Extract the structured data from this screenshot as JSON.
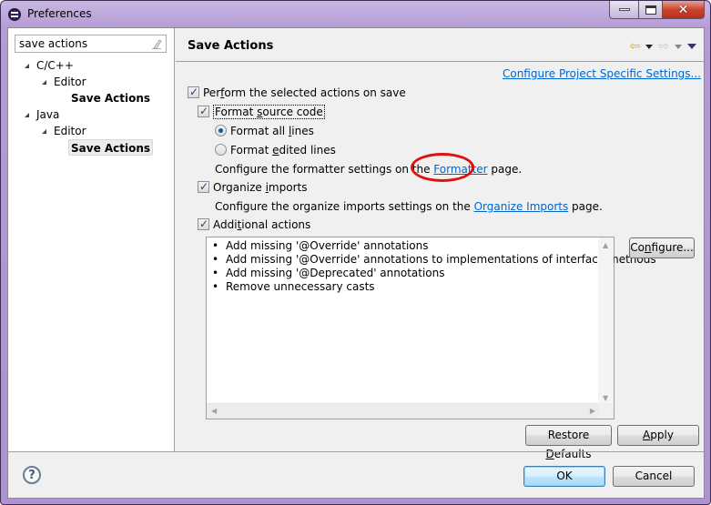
{
  "window": {
    "title": "Preferences",
    "controls": {
      "minimize": "minimize",
      "maximize": "maximize",
      "close": "close"
    }
  },
  "sidebar": {
    "filter": {
      "value": "save actions",
      "placeholder": ""
    },
    "tree": [
      {
        "label": "C/C++",
        "level": 0,
        "expanded": true
      },
      {
        "label": "Editor",
        "level": 1,
        "expanded": true
      },
      {
        "label": "Save Actions",
        "level": 2,
        "bold": true,
        "selected": false
      },
      {
        "label": "Java",
        "level": 0,
        "expanded": true
      },
      {
        "label": "Editor",
        "level": 1,
        "expanded": true
      },
      {
        "label": "Save Actions",
        "level": 2,
        "bold": true,
        "selected": true
      }
    ]
  },
  "page": {
    "title": "Save Actions",
    "project_settings_link": "Configure Project Specific Settings...",
    "perform_on_save": {
      "label_pre": "Per",
      "label_mn": "f",
      "label_post": "orm the selected actions on save",
      "checked": true
    },
    "format_source": {
      "label_pre": "Format ",
      "label_mn": "s",
      "label_post": "ource code",
      "checked": true
    },
    "format_all": {
      "label_pre": "Format all ",
      "label_mn": "l",
      "label_post": "ines",
      "selected": true
    },
    "format_edited": {
      "label_pre": "Format ",
      "label_mn": "e",
      "label_post": "dited lines",
      "selected": false
    },
    "formatter_text_pre": "Configure the formatter settings on the ",
    "formatter_link": "Formatter",
    "formatter_text_post": " page.",
    "organize_imports": {
      "label_pre": "Organize ",
      "label_mn": "i",
      "label_post": "mports",
      "checked": true
    },
    "organize_text_pre": "Configure the organize imports settings on the ",
    "organize_link": "Organize Imports",
    "organize_text_post": " page.",
    "additional_actions": {
      "label_pre": "Addi",
      "label_mn": "t",
      "label_post": "ional actions",
      "checked": true
    },
    "actions_list": [
      "Add missing '@Override' annotations",
      "Add missing '@Override' annotations to implementations of interface methods",
      "Add missing '@Deprecated' annotations",
      "Remove unnecessary casts"
    ],
    "bullet": "•",
    "configure_button": {
      "pre": "Co",
      "mn": "n",
      "post": "figure..."
    },
    "restore_defaults_button": {
      "pre": "Restore ",
      "mn": "D",
      "post": "efaults"
    },
    "apply_button": {
      "pre": "",
      "mn": "A",
      "post": "pply"
    }
  },
  "footer": {
    "help_glyph": "?",
    "ok_label": "OK",
    "cancel_label": "Cancel"
  },
  "annotation": {
    "color": "#e01010",
    "target": "Formatter link"
  }
}
